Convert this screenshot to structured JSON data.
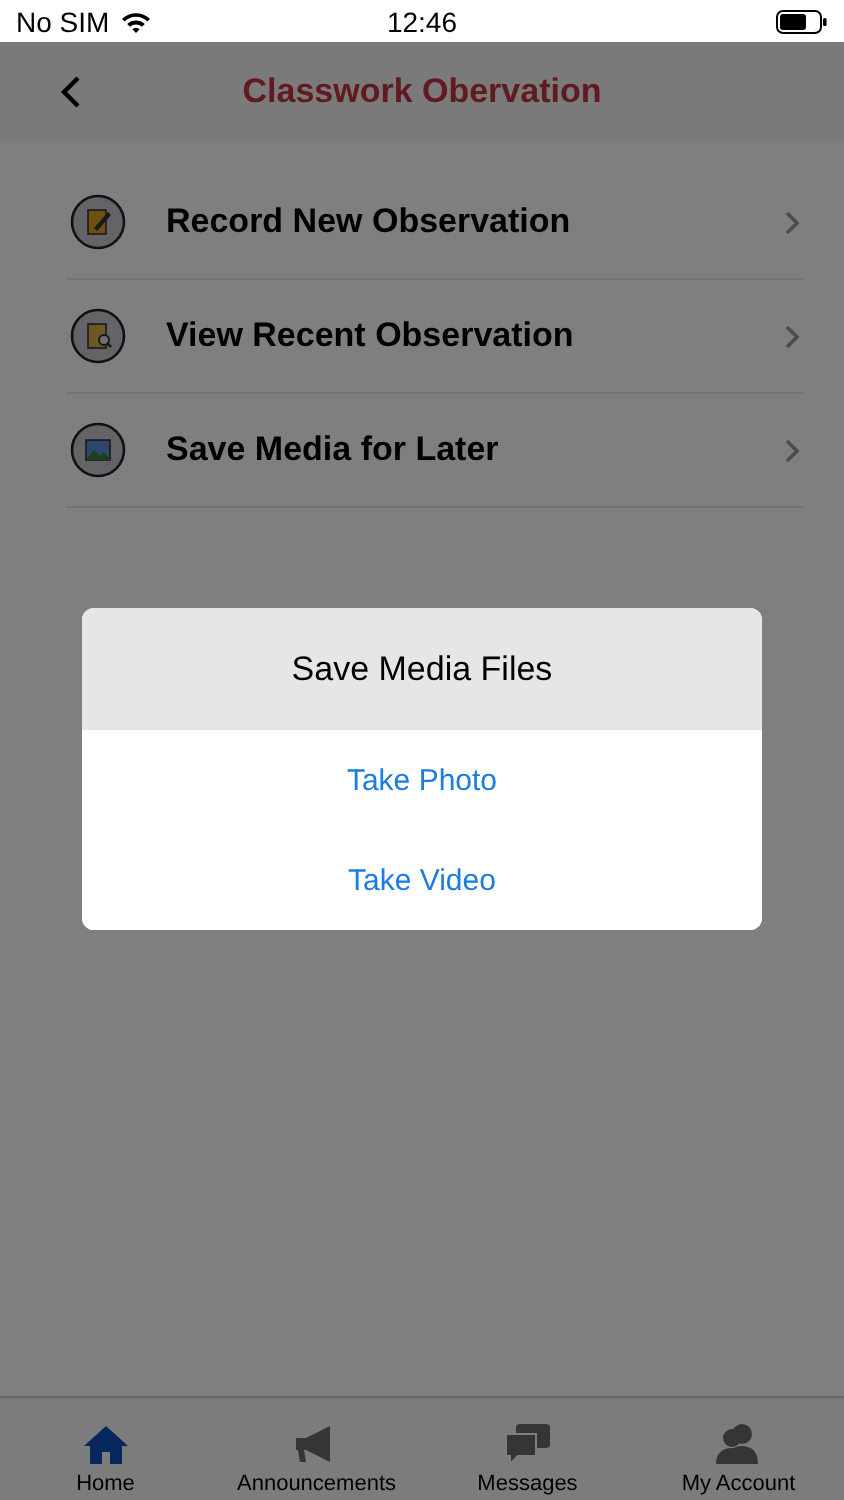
{
  "status_bar": {
    "carrier": "No SIM",
    "time": "12:46"
  },
  "header": {
    "title": "Classwork Obervation"
  },
  "menu": [
    {
      "label": "Record New Observation",
      "kind": "record"
    },
    {
      "label": "View Recent Observation",
      "kind": "view"
    },
    {
      "label": "Save Media for Later",
      "kind": "media"
    }
  ],
  "dialog": {
    "title": "Save Media Files",
    "actions": [
      "Take Photo",
      "Take Video"
    ]
  },
  "tab_bar": [
    {
      "label": "Home",
      "kind": "home",
      "selected": true
    },
    {
      "label": "Announcements",
      "kind": "announce",
      "selected": false
    },
    {
      "label": "Messages",
      "kind": "messages",
      "selected": false
    },
    {
      "label": "My Account",
      "kind": "account",
      "selected": false
    }
  ]
}
